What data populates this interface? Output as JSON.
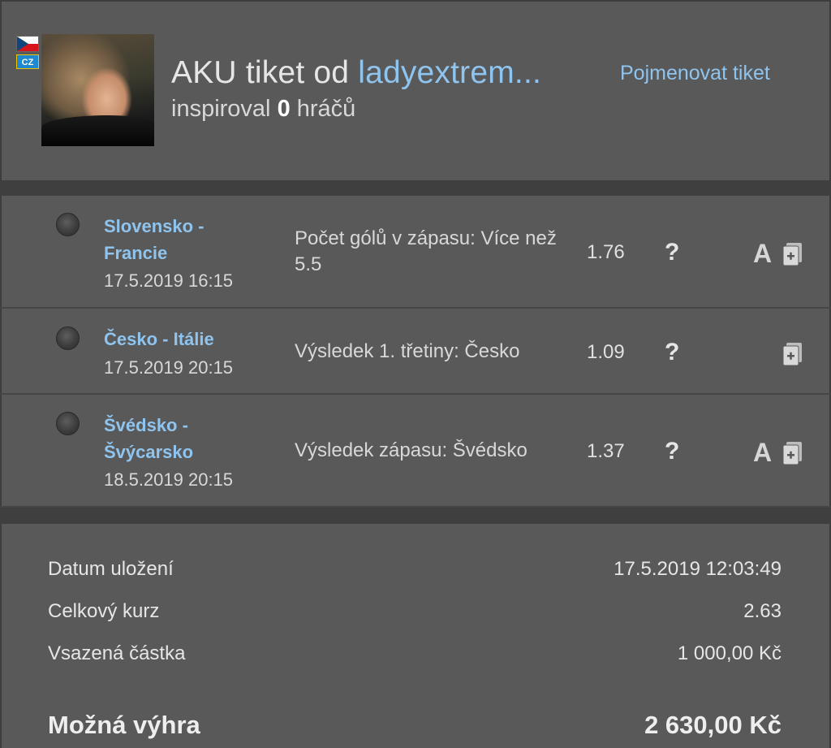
{
  "header": {
    "title_prefix": "AKU tiket od ",
    "username": "ladyextrem...",
    "inspired_prefix": "inspiroval ",
    "inspired_count": "0",
    "inspired_suffix": " hráčů",
    "rename_label": "Pojmenovat tiket",
    "badge_label": "CZ",
    "flag": "czech-flag-icon"
  },
  "bets": [
    {
      "match": "Slovensko - Francie",
      "date": "17.5.2019 16:15",
      "pick": "Počet gólů v zápasu: Více než 5.5",
      "odds": "1.76",
      "help": "?",
      "a_label": "A",
      "has_a": true
    },
    {
      "match": "Česko - Itálie",
      "date": "17.5.2019 20:15",
      "pick": "Výsledek 1. třetiny: Česko",
      "odds": "1.09",
      "help": "?",
      "a_label": "",
      "has_a": false
    },
    {
      "match": "Švédsko - Švýcarsko",
      "date": "18.5.2019 20:15",
      "pick": "Výsledek zápasu: Švédsko",
      "odds": "1.37",
      "help": "?",
      "a_label": "A",
      "has_a": true
    }
  ],
  "summary": {
    "saved_label": "Datum uložení",
    "saved_value": "17.5.2019 12:03:49",
    "total_odds_label": "Celkový kurz",
    "total_odds_value": "2.63",
    "stake_label": "Vsazená částka",
    "stake_value": "1 000,00 Kč",
    "win_label": "Možná výhra",
    "win_value": "2 630,00 Kč"
  },
  "colors": {
    "background": "#595959",
    "separator": "#3f3f3f",
    "link": "#8fc4ef",
    "text": "#e6e6e6"
  }
}
